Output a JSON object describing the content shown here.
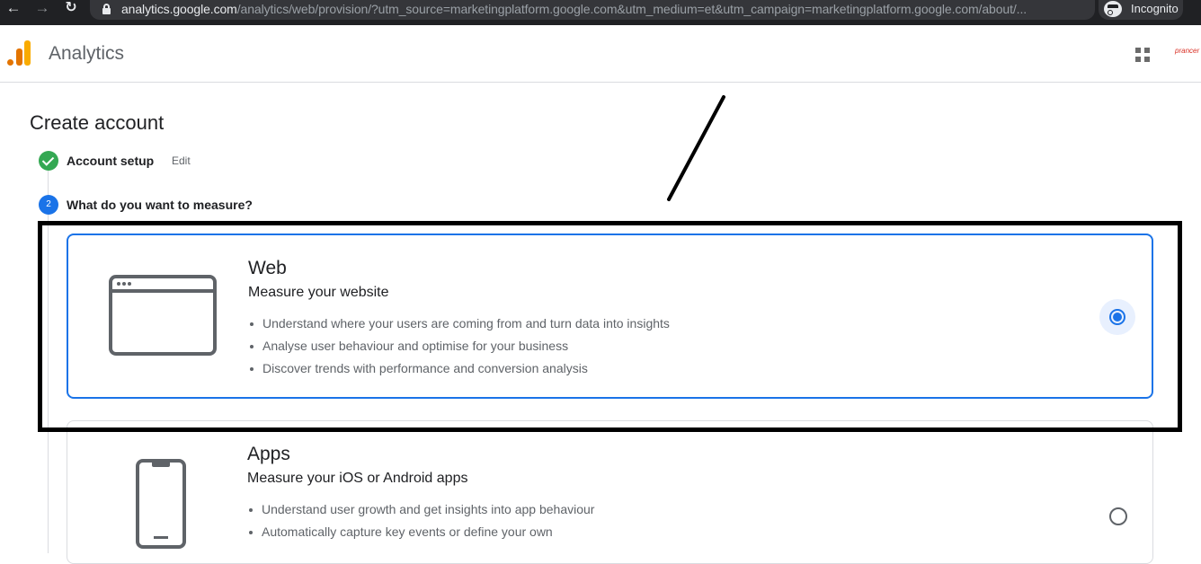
{
  "browser": {
    "nav": {
      "back_icon": "←",
      "forward_icon": "→",
      "reload_icon": "↻"
    },
    "url_host": "analytics.google.com",
    "url_path": "/analytics/web/provision/?utm_source=marketingplatform.google.com&utm_medium=et&utm_campaign=marketingplatform.google.com/about/...",
    "star_icon": "☆",
    "profile_label": "Incognito"
  },
  "header": {
    "app_title": "Analytics",
    "brand_text": "prancer"
  },
  "page": {
    "title": "Create account",
    "steps": [
      {
        "label": "Account setup",
        "status": "complete",
        "edit_label": "Edit"
      },
      {
        "number": "2",
        "label": "What do you want to measure?",
        "status": "active"
      }
    ]
  },
  "options": [
    {
      "title": "Web",
      "subtitle": "Measure your website",
      "selected": true,
      "bullets": [
        "Understand where your users are coming from and turn data into insights",
        "Analyse user behaviour and optimise for your business",
        "Discover trends with performance and conversion analysis"
      ]
    },
    {
      "title": "Apps",
      "subtitle": "Measure your iOS or Android apps",
      "selected": false,
      "bullets": [
        "Understand user growth and get insights into app behaviour",
        "Automatically capture key events or define your own"
      ]
    }
  ],
  "colors": {
    "accent": "#1a73e8",
    "success": "#34a853",
    "logo_orange": "#e37400",
    "logo_yellow": "#f9ab00"
  }
}
